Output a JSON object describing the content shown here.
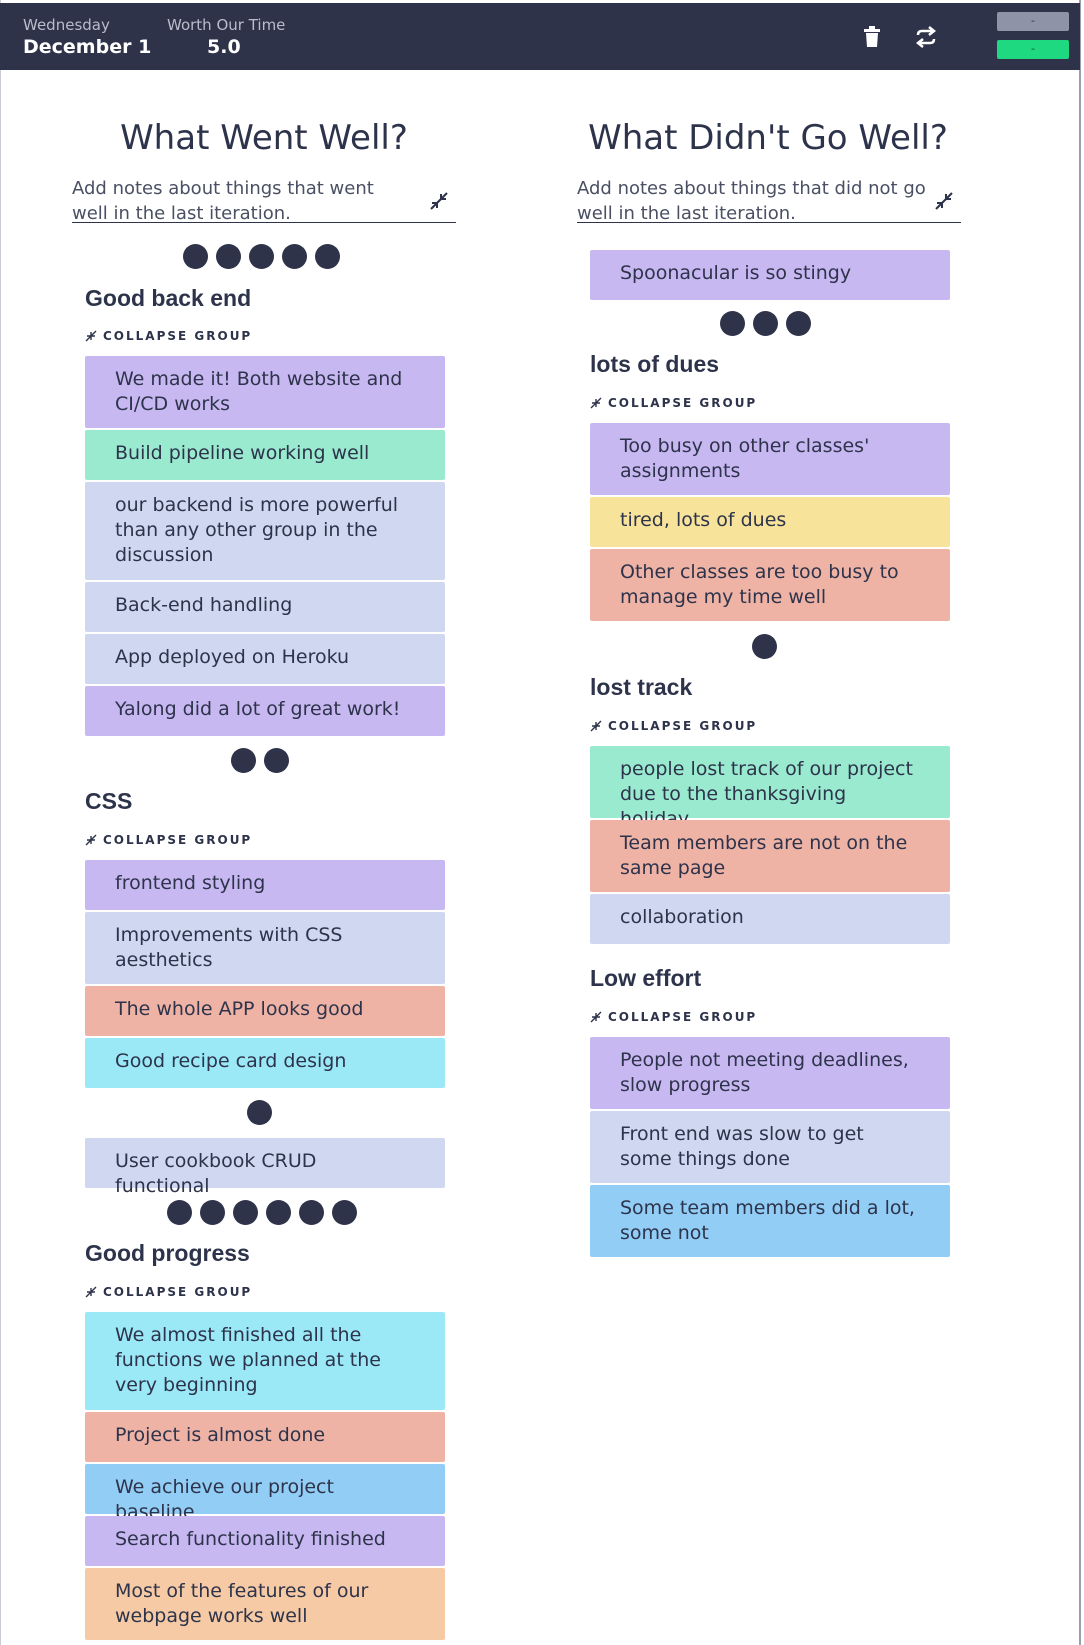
{
  "header": {
    "day_label": "Wednesday",
    "date": "December 1",
    "metric_label": "Worth Our Time",
    "metric_value": "5.0",
    "pill_gray_label": "-",
    "pill_green_label": "-",
    "icons": [
      "trash-icon",
      "refresh-icon"
    ]
  },
  "left": {
    "title": "What Went Well?",
    "placeholder": "Add notes about things that went well in the last iteration.",
    "groups": [
      {
        "title": "Good back end",
        "collapse_label": "COLLAPSE GROUP",
        "cards": [
          "We made it! Both website and CI/CD works",
          "Build pipeline working well",
          "our backend is more powerful than any other group in the discussion",
          "Back-end handling",
          "App deployed on Heroku",
          "Yalong did a lot of great work!"
        ]
      },
      {
        "title": "CSS",
        "collapse_label": "COLLAPSE GROUP",
        "cards": [
          "frontend styling",
          "Improvements with CSS aesthetics",
          "The whole APP looks good",
          "Good recipe card design"
        ]
      },
      {
        "title": "",
        "cards": [
          "User cookbook CRUD functional"
        ]
      },
      {
        "title": "Good progress",
        "collapse_label": "COLLAPSE GROUP",
        "cards": [
          "We almost finished all the functions we planned at the very beginning",
          "Project is almost done",
          "We achieve our project baseline",
          "Search functionality finished",
          "Most of the features of our webpage works well"
        ]
      }
    ],
    "dot_counts": [
      5,
      2,
      1,
      6
    ]
  },
  "right": {
    "title": "What Didn't Go Well?",
    "placeholder": "Add notes about things that did not go well in the last iteration.",
    "groups": [
      {
        "title": "",
        "cards": [
          "Spoonacular is so stingy"
        ]
      },
      {
        "title": "lots of dues",
        "collapse_label": "COLLAPSE GROUP",
        "cards": [
          "Too busy on other classes' assignments",
          "tired, lots of dues",
          "Other classes are too busy to manage my time well"
        ]
      },
      {
        "title": "lost track",
        "collapse_label": "COLLAPSE GROUP",
        "cards": [
          "people lost track of our project due to the thanksgiving holiday",
          "Team members are not on the same page",
          "collaboration"
        ]
      },
      {
        "title": "Low effort",
        "collapse_label": "COLLAPSE GROUP",
        "cards": [
          "People not meeting deadlines, slow progress",
          "Front end was slow to get some things done",
          "Some team members did a lot, some not"
        ]
      }
    ],
    "dot_counts": [
      3,
      1
    ]
  },
  "colors": {
    "header_bg": "#2f3349",
    "purple": "#c8b8f2",
    "green": "#9aead0",
    "lavender": "#cfd8f0",
    "salmon": "#efb3a6",
    "cyan": "#9be9f7",
    "blue": "#92cdf5",
    "yellow": "#f8e39a",
    "orange": "#f6caa5",
    "accent_green": "#1ed97f"
  }
}
